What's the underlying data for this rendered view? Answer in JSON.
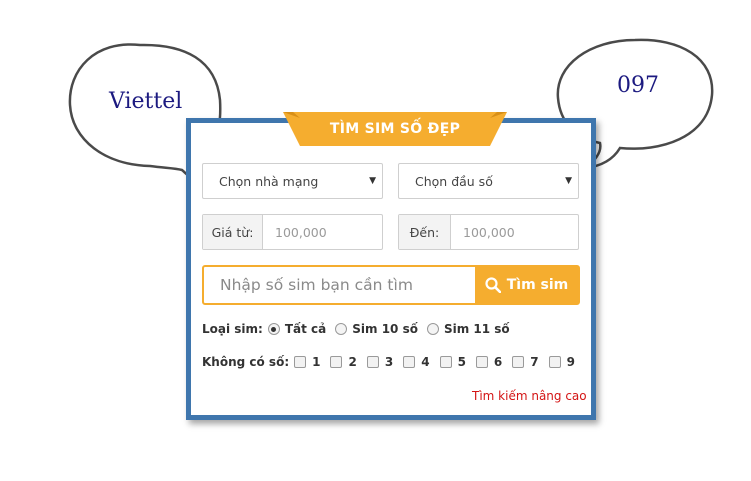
{
  "bubbles": {
    "left_text": "Viettel",
    "right_text": "097"
  },
  "panel": {
    "title": "TÌM SIM SỐ ĐẸP",
    "network_select": "Chọn nhà mạng",
    "prefix_select": "Chọn đầu số",
    "price_from": {
      "label": "Giá từ:",
      "value": "100,000"
    },
    "price_to": {
      "label": "Đến:",
      "value": "100,000"
    },
    "search": {
      "placeholder": "Nhập số sim bạn cần tìm",
      "button": "Tìm sim"
    },
    "sim_type": {
      "label": "Loại sim:",
      "options": [
        {
          "label": "Tất cả",
          "checked": true
        },
        {
          "label": "Sim 10 số",
          "checked": false
        },
        {
          "label": "Sim 11 số",
          "checked": false
        }
      ]
    },
    "exclude_digits": {
      "label": "Không có số:",
      "digits": [
        "1",
        "2",
        "3",
        "4",
        "5",
        "6",
        "7",
        "9"
      ]
    },
    "advanced_link": "Tìm kiếm nâng cao"
  },
  "colors": {
    "accent": "#f5ad2f",
    "border": "#3f76ad",
    "link": "#d41414"
  },
  "icons": {
    "search": "magnifier-icon",
    "caret": "caret-down-icon"
  }
}
